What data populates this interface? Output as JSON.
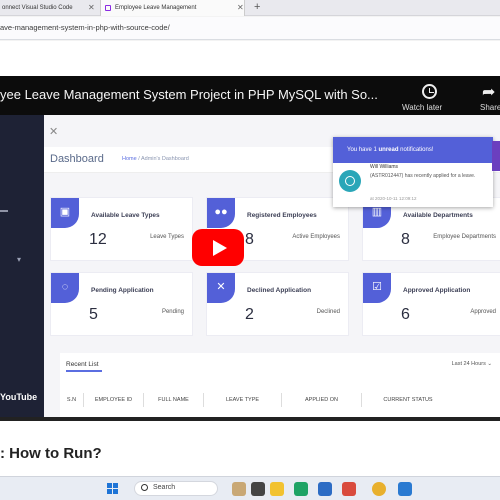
{
  "browser": {
    "tabs": [
      {
        "label": "onnect Visual Studio Code"
      },
      {
        "label": "Employee Leave Management"
      }
    ],
    "url": "ave-management-system-in-php-with-source-code/"
  },
  "video": {
    "title": "yee Leave Management System Project in PHP MySQL with So...",
    "watch_later_label": "Watch later",
    "share_label": "Share",
    "youtube_wordmark": "YouTube"
  },
  "dashboard": {
    "page_title": "Dashboard",
    "breadcrumb_home": "Home",
    "breadcrumb_current": "Admin's Dashboard",
    "cards": [
      {
        "title": "Available Leave Types",
        "value": "12",
        "sub": "Leave Types",
        "icon": "briefcase-icon"
      },
      {
        "title": "Registered Employees",
        "value": "8",
        "sub": "Active Employees",
        "icon": "users-icon"
      },
      {
        "title": "Available Departments",
        "value": "8",
        "sub": "Employee Departments",
        "icon": "building-icon"
      },
      {
        "title": "Pending Application",
        "value": "5",
        "sub": "Pending",
        "icon": "spinner-icon"
      },
      {
        "title": "Declined Application",
        "value": "2",
        "sub": "Declined",
        "icon": "x-icon"
      },
      {
        "title": "Approved Application",
        "value": "6",
        "sub": "Approved",
        "icon": "check-icon"
      }
    ],
    "recent": {
      "title": "Recent List",
      "filter": "Last 24 Hours",
      "columns": [
        "S.N",
        "EMPLOYEE ID",
        "FULL NAME",
        "LEAVE TYPE",
        "APPLIED ON",
        "CURRENT STATUS"
      ]
    },
    "notification": {
      "header_prefix": "You have 1 ",
      "header_bold": "unread",
      "header_suffix": " notifications!",
      "name": "Will Williams",
      "message": "(ASTR012447) has recently applied for a leave.",
      "date": "at 2020-10-11 12:09:12"
    }
  },
  "page": {
    "heading": ": How to Run?"
  },
  "taskbar": {
    "search_label": "Search"
  },
  "colors": {
    "accent": "#5360d8",
    "sidebar": "#1e2235",
    "youtube_red": "#ff0000"
  }
}
